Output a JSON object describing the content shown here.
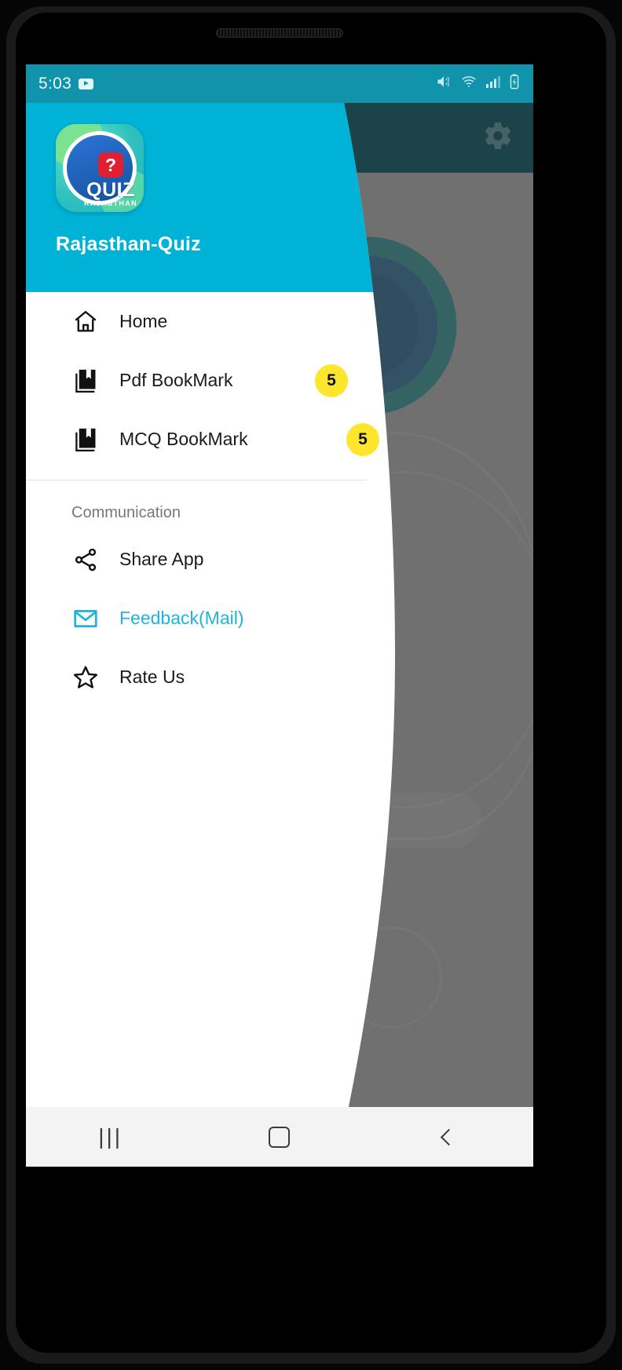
{
  "status_bar": {
    "time": "5:03",
    "icons": [
      "youtube-icon",
      "mute-vibrate-icon",
      "wifi-icon",
      "signal-icon",
      "battery-icon"
    ]
  },
  "app_bar": {
    "settings_icon": "gear-icon"
  },
  "drawer": {
    "app_title": "Rajasthan-Quiz",
    "logo": {
      "question_mark": "?",
      "quiz_text": "QUIZ",
      "sub_text": "RAJASTHAN"
    },
    "items": [
      {
        "label": "Home",
        "icon": "home-icon",
        "badge": null,
        "accent": false
      },
      {
        "label": "Pdf BookMark",
        "icon": "bookmark-library-icon",
        "badge": "5",
        "accent": false
      },
      {
        "label": "MCQ BookMark",
        "icon": "bookmark-library-icon",
        "badge": "5",
        "accent": false
      }
    ],
    "section": {
      "title": "Communication",
      "items": [
        {
          "label": "Share App",
          "icon": "share-icon",
          "accent": false
        },
        {
          "label": "Feedback(Mail)",
          "icon": "mail-icon",
          "accent": true
        },
        {
          "label": "Rate Us",
          "icon": "star-outline-icon",
          "accent": false
        }
      ]
    }
  },
  "system_nav": {
    "recents": "|||",
    "home": "home-square-icon",
    "back": "back-chevron-icon"
  },
  "colors": {
    "status_bar": "#1193ab",
    "drawer_header": "#00b2d6",
    "accent": "#1eb4dd",
    "badge": "#ffe62e",
    "app_bar_dim": "#024a55"
  }
}
